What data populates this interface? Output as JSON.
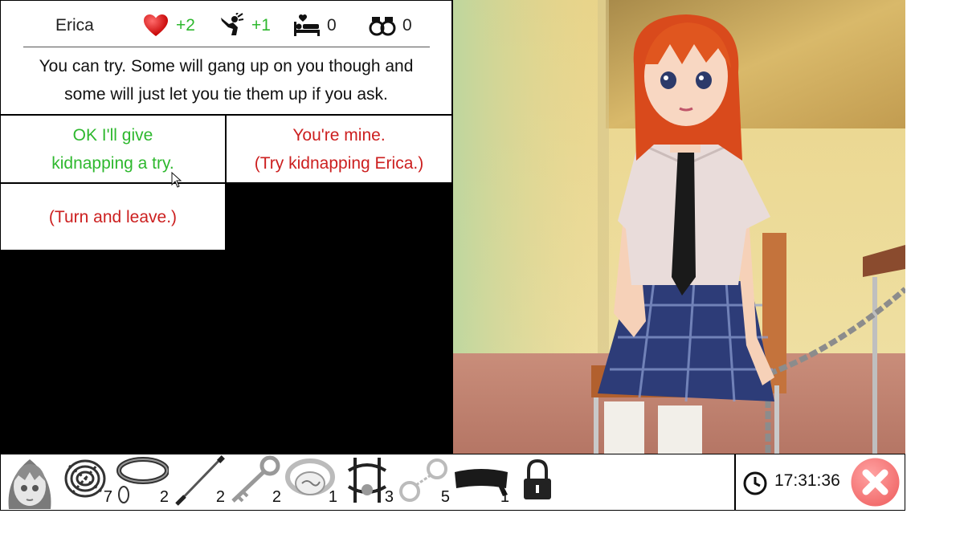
{
  "character": {
    "name": "Erica"
  },
  "stats": [
    {
      "icon": "heart-icon",
      "value": "+2",
      "color": "#2eb82e"
    },
    {
      "icon": "kneeling-figure-icon",
      "value": "+1",
      "color": "#2eb82e"
    },
    {
      "icon": "bed-heart-icon",
      "value": "0",
      "color": "#222222"
    },
    {
      "icon": "handcuffs-icon",
      "value": "0",
      "color": "#222222"
    }
  ],
  "dialog": {
    "line1": "You can try. Some will gang up on you though and",
    "line2": "some will just let you tie them up if you ask."
  },
  "choices": [
    {
      "line1": "OK I'll give",
      "line2": "kidnapping a try.",
      "color": "#2eb82e"
    },
    {
      "line1": "You're mine.",
      "line2": "(Try kidnapping Erica.)",
      "color": "#cc1f1f"
    },
    {
      "line1": "(Turn and leave.)",
      "color": "#cc1f1f"
    }
  ],
  "inventory": [
    {
      "icon": "character-portrait-icon",
      "count": ""
    },
    {
      "icon": "rope-icon",
      "count": "7"
    },
    {
      "icon": "collar-icon",
      "count": "2"
    },
    {
      "icon": "riding-crop-icon",
      "count": "2"
    },
    {
      "icon": "key-icon",
      "count": "2"
    },
    {
      "icon": "cloth-gag-icon",
      "count": "1"
    },
    {
      "icon": "harness-gag-icon",
      "count": "3"
    },
    {
      "icon": "handcuffs-icon",
      "count": "5"
    },
    {
      "icon": "blindfold-icon",
      "count": "1"
    },
    {
      "icon": "lock-icon",
      "count": ""
    }
  ],
  "clock": {
    "icon": "clock-icon",
    "time": "17:31:36"
  },
  "close": {
    "icon": "close-icon",
    "color": "#f26d6d"
  }
}
